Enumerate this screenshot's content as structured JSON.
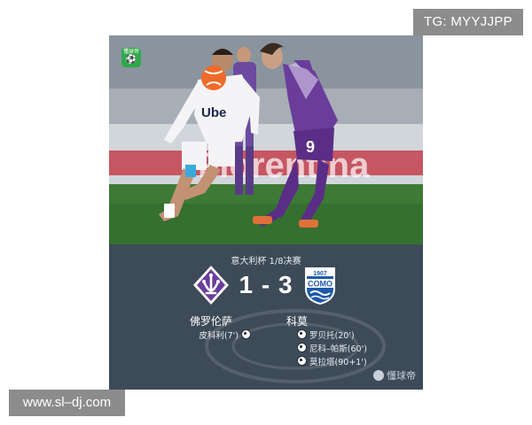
{
  "overlay": {
    "top_right_tag": "TG: MYYJJPP",
    "bottom_left_tag": "www.sl–dj.com"
  },
  "app_logo": {
    "text": "懂球帝",
    "icon": "ball-icon"
  },
  "photo": {
    "description_icon": "match-photo",
    "banner_text": "Fiorentina",
    "shirt_text": "Ube",
    "shirt_number": "9"
  },
  "match": {
    "competition": "意大利杯 1/8决赛",
    "score": "1 - 3",
    "home": {
      "name": "佛罗伦萨",
      "crest": "fiorentina-crest",
      "crest_color": "#6a3d9a",
      "scorers": [
        "皮科利(7')"
      ]
    },
    "away": {
      "name": "科莫",
      "crest": "como-crest",
      "crest_color": "#1e5aa8",
      "crest_text": "COMO",
      "crest_year": "1907",
      "scorers": [
        "罗贝托(20')",
        "尼科–帕斯(60')",
        "莫拉塔(90+1')"
      ]
    }
  },
  "brand": {
    "text": "懂球帝"
  }
}
